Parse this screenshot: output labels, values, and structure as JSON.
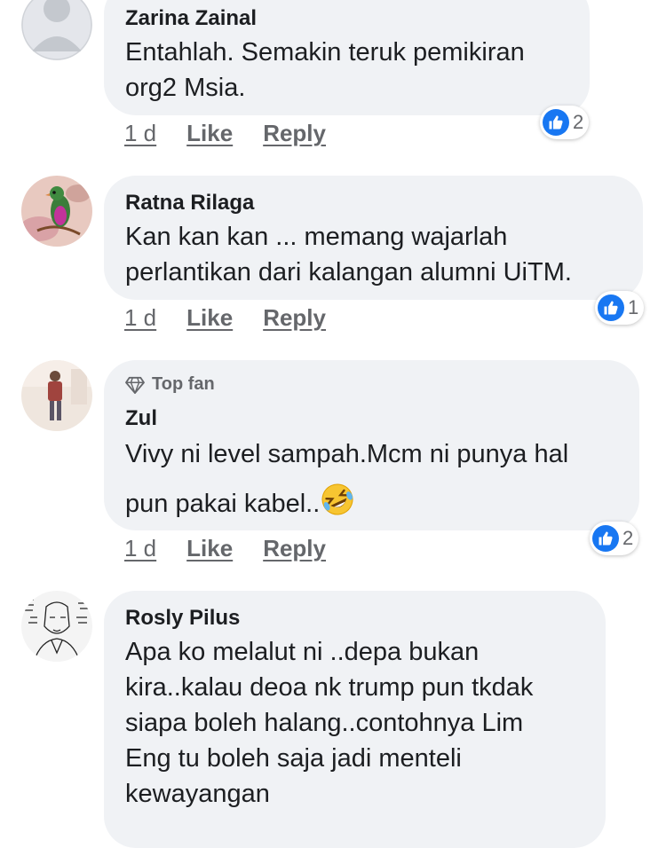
{
  "comments": [
    {
      "author": "Zarina Zainal",
      "lines": [
        "Entahlah. Semakin teruk pemikiran",
        "org2 Msia."
      ],
      "time": "1 d",
      "like_label": "Like",
      "reply_label": "Reply",
      "reaction_count": "2",
      "avatar": "default-avatar-icon"
    },
    {
      "author": "Ratna Rilaga",
      "lines": [
        "Kan kan kan ... memang wajarlah",
        "perlantikan dari kalangan alumni UiTM."
      ],
      "time": "1 d",
      "like_label": "Like",
      "reply_label": "Reply",
      "reaction_count": "1",
      "avatar": "bird-photo-avatar"
    },
    {
      "badge": "Top fan",
      "author": "Zul",
      "lines": [
        "Vivy ni level sampah.Mcm ni punya hal",
        "pun pakai kabel.."
      ],
      "emoji": "rolling-on-floor-laughing-emoji",
      "time": "1 d",
      "like_label": "Like",
      "reply_label": "Reply",
      "reaction_count": "2",
      "avatar": "person-photo-avatar"
    },
    {
      "author": "Rosly Pilus",
      "lines": [
        "Apa ko melalut ni ..depa bukan",
        "kira..kalau deoa nk trump pun tkdak",
        "siapa boleh halang..contohnya Lim",
        "Eng tu boleh saja jadi menteli",
        "kewayangan"
      ],
      "avatar": "sketch-portrait-avatar"
    }
  ],
  "colors": {
    "bubble": "#f0f2f5",
    "like_blue": "#1877f2",
    "meta_gray": "#65676b"
  }
}
